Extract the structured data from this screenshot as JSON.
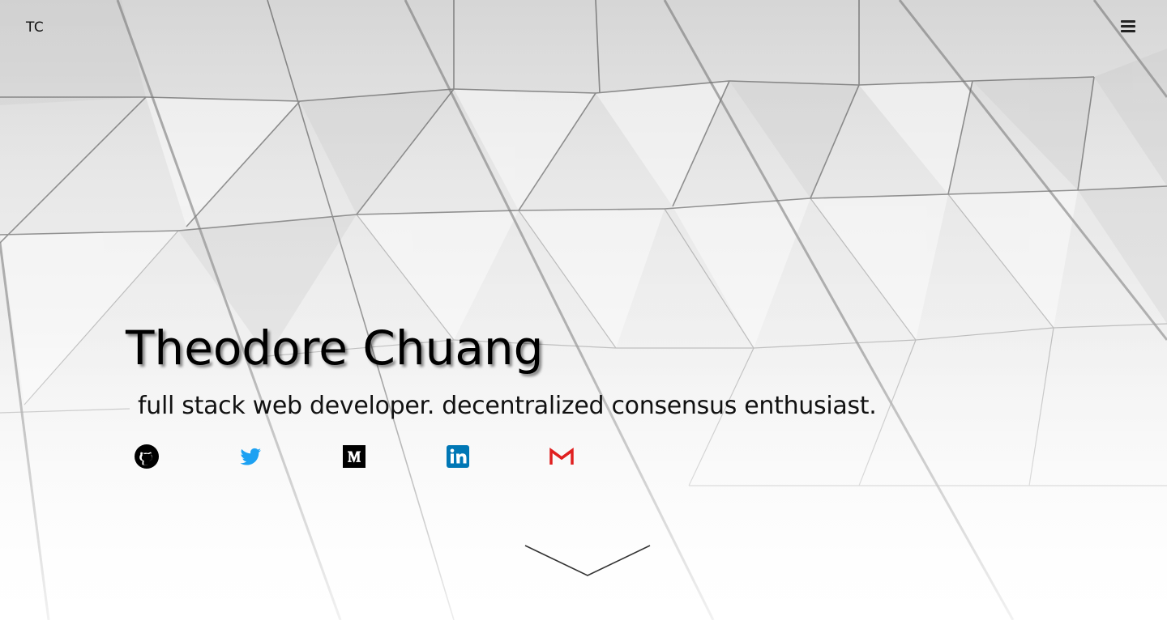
{
  "nav": {
    "brand": "TC",
    "menu_icon": "hamburger-menu-icon"
  },
  "hero": {
    "title": "Theodore Chuang",
    "subtitle": "full stack web developer. decentralized consensus enthusiast."
  },
  "social": [
    {
      "name": "github",
      "icon": "github-icon",
      "color": "#000000"
    },
    {
      "name": "twitter",
      "icon": "twitter-icon",
      "color": "#1DA1F2"
    },
    {
      "name": "medium",
      "icon": "medium-icon",
      "color": "#000000"
    },
    {
      "name": "linkedin",
      "icon": "linkedin-icon",
      "color": "#0077B5"
    },
    {
      "name": "gmail",
      "icon": "gmail-icon",
      "color": "#E02020"
    }
  ],
  "scroll_indicator": {
    "icon": "chevron-down-icon"
  }
}
